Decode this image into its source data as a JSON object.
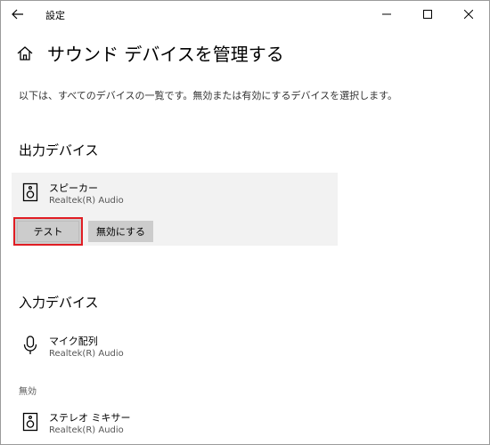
{
  "window": {
    "title": "設定"
  },
  "header": {
    "title": "サウンド デバイスを管理する",
    "description": "以下は、すべてのデバイスの一覧です。無効または有効にするデバイスを選択します。"
  },
  "output_section": {
    "heading": "出力デバイス",
    "devices": [
      {
        "name": "スピーカー",
        "subtitle": "Realtek(R) Audio",
        "icon": "speaker-icon",
        "selected": true,
        "buttons": {
          "test": "テスト",
          "disable": "無効にする"
        }
      }
    ]
  },
  "input_section": {
    "heading": "入力デバイス",
    "devices": [
      {
        "name": "マイク配列",
        "subtitle": "Realtek(R) Audio",
        "icon": "microphone-icon"
      }
    ],
    "disabled_label": "無効",
    "disabled_devices": [
      {
        "name": "ステレオ ミキサー",
        "subtitle": "Realtek(R) Audio",
        "icon": "speaker-icon"
      }
    ]
  },
  "colors": {
    "highlight_border": "#e01d23",
    "card_background": "#f2f2f2",
    "button_background": "#cccccc"
  }
}
